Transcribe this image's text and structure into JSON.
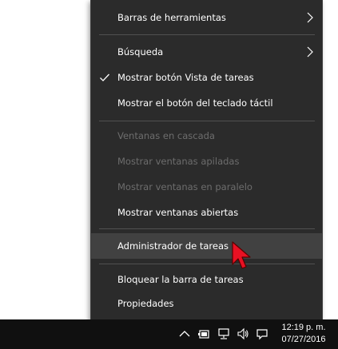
{
  "menu": {
    "items": [
      {
        "label": "Barras de herramientas",
        "enabled": true,
        "checked": false,
        "submenu": true
      },
      {
        "label": "Búsqueda",
        "enabled": true,
        "checked": false,
        "submenu": true
      },
      {
        "label": "Mostrar botón Vista de tareas",
        "enabled": true,
        "checked": true,
        "submenu": false
      },
      {
        "label": "Mostrar el botón del teclado táctil",
        "enabled": true,
        "checked": false,
        "submenu": false
      },
      {
        "label": "Ventanas en cascada",
        "enabled": false,
        "checked": false,
        "submenu": false
      },
      {
        "label": "Mostrar ventanas apiladas",
        "enabled": false,
        "checked": false,
        "submenu": false
      },
      {
        "label": "Mostrar ventanas en paralelo",
        "enabled": false,
        "checked": false,
        "submenu": false
      },
      {
        "label": "Mostrar ventanas abiertas",
        "enabled": true,
        "checked": false,
        "submenu": false
      },
      {
        "label": "Administrador de tareas",
        "enabled": true,
        "checked": false,
        "submenu": false,
        "hovered": true
      },
      {
        "label": "Bloquear la barra de tareas",
        "enabled": true,
        "checked": false,
        "submenu": false
      },
      {
        "label": "Propiedades",
        "enabled": true,
        "checked": false,
        "submenu": false
      }
    ]
  },
  "taskbar": {
    "tray_icons": [
      "chevron-up-icon",
      "power-icon",
      "network-icon",
      "volume-icon",
      "notification-icon"
    ],
    "clock": {
      "time": "12:19 p. m.",
      "date": "07/27/2016"
    }
  },
  "colors": {
    "menu_bg": "#2b2b2b",
    "menu_hover": "#414141",
    "text": "#ffffff",
    "text_disabled": "#6d6d6d",
    "taskbar_bg": "#101010",
    "cursor": "#e81123"
  }
}
